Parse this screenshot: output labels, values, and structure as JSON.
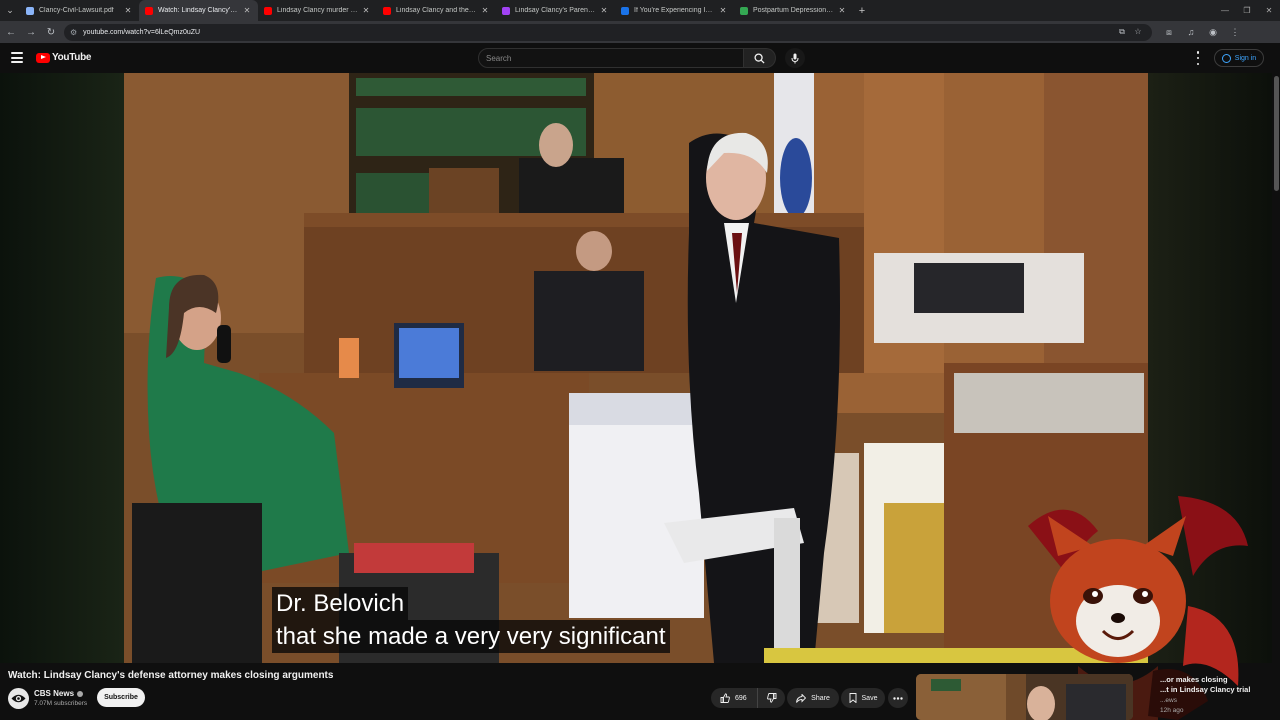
{
  "browser": {
    "tabs": [
      {
        "title": "Clancy-Civil-Lawsuit.pdf",
        "icon": "pdf-icon",
        "color": "#8ab4f8",
        "active": false
      },
      {
        "title": "Watch: Lindsay Clancy's defe",
        "icon": "youtube-icon",
        "color": "#ff0000",
        "active": true
      },
      {
        "title": "Lindsay Clancy murder trial: Pro",
        "icon": "youtube-icon",
        "color": "#ff0000",
        "active": false
      },
      {
        "title": "Lindsay Clancy and the Evidenc",
        "icon": "youtube-icon",
        "color": "#ff0000",
        "active": false
      },
      {
        "title": "Lindsay Clancy's Parents' $1 Mi",
        "icon": "pdf-icon",
        "color": "#a142f4",
        "active": false
      },
      {
        "title": "If You're Experiencing Intrusive",
        "icon": "web-icon",
        "color": "#1a73e8",
        "active": false
      },
      {
        "title": "Postpartum Depression (PPD):",
        "icon": "web-icon",
        "color": "#34a853",
        "active": false
      }
    ],
    "url": "youtube.com/watch?v=6lLeQmz0uZU"
  },
  "header": {
    "logo_text": "YouTube",
    "search_placeholder": "Search",
    "signin_label": "Sign in"
  },
  "video": {
    "caption_line1": "Dr. Belovich",
    "caption_line2": "that she made a very very significant",
    "title": "Watch: Lindsay Clancy's defense attorney makes closing arguments",
    "channel": "CBS News",
    "subscribers": "7.07M subscribers",
    "subscribe_label": "Subscribe",
    "likes": "696",
    "share_label": "Share",
    "save_label": "Save"
  },
  "related": {
    "title_line1": "...or makes closing",
    "title_line2": "...t in Lindsay Clancy trial",
    "channel": "...ews",
    "age": "12h ago"
  }
}
